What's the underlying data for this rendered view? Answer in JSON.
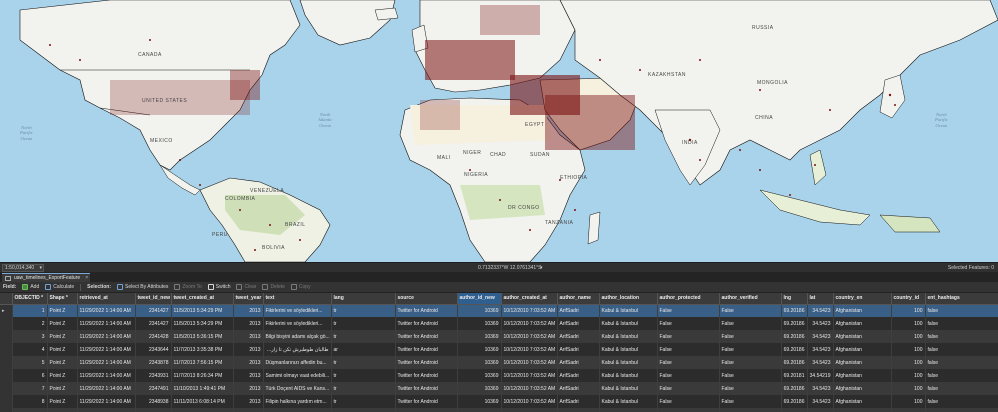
{
  "map": {
    "continent_labels": [
      {
        "id": "canada",
        "text": "CANADA"
      },
      {
        "id": "united-states",
        "text": "UNITED STATES"
      },
      {
        "id": "mexico",
        "text": "MEXICO"
      },
      {
        "id": "brazil",
        "text": "BRAZIL"
      },
      {
        "id": "russia",
        "text": "RUSSIA"
      },
      {
        "id": "kazakhstan",
        "text": "KAZAKHSTAN"
      },
      {
        "id": "mongolia",
        "text": "MONGOLIA"
      },
      {
        "id": "china",
        "text": "CHINA"
      },
      {
        "id": "india",
        "text": "INDIA"
      },
      {
        "id": "mali",
        "text": "MALI"
      },
      {
        "id": "niger",
        "text": "NIGER"
      },
      {
        "id": "chad",
        "text": "CHAD"
      },
      {
        "id": "sudan",
        "text": "SUDAN"
      },
      {
        "id": "egypt",
        "text": "EGYPT"
      },
      {
        "id": "ethiopia",
        "text": "ETHIOPIA"
      },
      {
        "id": "nigeria",
        "text": "NIGERIA"
      },
      {
        "id": "dr-congo",
        "text": "DR CONGO"
      },
      {
        "id": "tanzania",
        "text": "TANZANIA"
      },
      {
        "id": "peru",
        "text": "PERU"
      },
      {
        "id": "bolivia",
        "text": "BOLIVIA"
      },
      {
        "id": "colombia",
        "text": "COLOMBIA"
      },
      {
        "id": "venezuela",
        "text": "VENEZUELA"
      }
    ],
    "ocean_labels": [
      {
        "id": "north-pacific",
        "text": "North\nPacific\nOcean"
      },
      {
        "id": "north-atlantic",
        "text": "North\nAtlantic\nOcean"
      },
      {
        "id": "north-pacific-east",
        "text": "North\nPacific\nOcean"
      }
    ]
  },
  "statusbar": {
    "scale": "1:50,014,340",
    "coordinates": "0.7132337°W 12.0761341°S",
    "selected_features": "Selected Features: 0"
  },
  "table_tab": {
    "title": "uaw_timelines_ExportFeature"
  },
  "toolbar": {
    "field_label": "Field:",
    "add": "Add",
    "calculate": "Calculate",
    "selection_label": "Selection:",
    "select_by_attributes": "Select By Attributes",
    "zoom_to": "Zoom To",
    "switch": "Switch",
    "clear": "Clear",
    "delete": "Delete",
    "copy": "Copy"
  },
  "table": {
    "columns": [
      "",
      "OBJECTID *",
      "Shape *",
      "retrieved_at",
      "tweet_id_new",
      "tweet_created_at",
      "tweet_year",
      "text",
      "lang",
      "source",
      "author_id_new",
      "author_created_at",
      "author_name",
      "author_location",
      "author_protected",
      "author_verified",
      "lng",
      "lat",
      "country_en",
      "country_id",
      "ent_hashtags"
    ],
    "rows": [
      [
        "▸",
        "1",
        "Point Z",
        "11/29/2022 1:14:00 AM",
        "2341427",
        "11/5/2013 5:34:29 PM",
        "2013",
        "Fikirlerini ve söyledikleri...",
        "tr",
        "Twitter for Android",
        "10369",
        "10/12/2010 7:03:52 AM",
        "ArifSadri",
        "Kabul & Istanbul",
        "False",
        "False",
        "69.20186",
        "34.5423",
        "Afghanistan",
        "100",
        "false"
      ],
      [
        "",
        "2",
        "Point Z",
        "11/29/2022 1:14:00 AM",
        "2341427",
        "11/5/2013 5:34:29 PM",
        "2013",
        "Fikirlerini ve söyledikleri...",
        "tr",
        "Twitter for Android",
        "10369",
        "10/12/2010 7:03:52 AM",
        "ArifSadri",
        "Kabul & Istanbul",
        "False",
        "False",
        "69.20186",
        "34.5423",
        "Afghanistan",
        "100",
        "false"
      ],
      [
        "",
        "3",
        "Point Z",
        "11/29/2022 1:14:00 AM",
        "2341428",
        "11/5/2013 5:36:15 PM",
        "2013",
        "Bilgi bisyini adamı alçak gö...",
        "tr",
        "Twitter for Android",
        "10369",
        "10/12/2010 7:03:52 AM",
        "ArifSadri",
        "Kabul & Istanbul",
        "False",
        "False",
        "69.20186",
        "34.5423",
        "Afghanistan",
        "100",
        "false"
      ],
      [
        "",
        "4",
        "Point Z",
        "11/29/2022 1:14:00 AM",
        "2343644",
        "11/7/2013 3:35:38 PM",
        "2013",
        "طالبان طوطبرش تکن تا زار...",
        "ar",
        "Twitter for Android",
        "10369",
        "10/12/2010 7:03:52 AM",
        "ArifSadri",
        "Kabul & Istanbul",
        "False",
        "False",
        "69.20186",
        "34.5423",
        "Afghanistan",
        "100",
        "false"
      ],
      [
        "",
        "5",
        "Point Z",
        "11/29/2022 1:14:00 AM",
        "2343878",
        "11/7/2013 7:56:15 PM",
        "2013",
        "Düşmanlarınızı affedin bu...",
        "tr",
        "Twitter for Android",
        "10369",
        "10/12/2010 7:03:52 AM",
        "ArifSadri",
        "Kabul & Istanbul",
        "False",
        "False",
        "69.20186",
        "34.5423",
        "Afghanistan",
        "100",
        "false"
      ],
      [
        "",
        "6",
        "Point Z",
        "11/29/2022 1:14:00 AM",
        "2343931",
        "11/7/2013 8:26:34 PM",
        "2013",
        "Samimi olmayı vaat edebili...",
        "tr",
        "Twitter for Android",
        "10369",
        "10/12/2010 7:03:52 AM",
        "ArifSadri",
        "Kabul & Istanbul",
        "False",
        "False",
        "69.20181",
        "34.54219",
        "Afghanistan",
        "100",
        "false"
      ],
      [
        "",
        "7",
        "Point Z",
        "11/29/2022 1:14:00 AM",
        "2347491",
        "11/10/2013 1:49:41 PM",
        "2013",
        "Türk Doçent AIDS ve Kans...",
        "tr",
        "Twitter for Android",
        "10369",
        "10/12/2010 7:03:52 AM",
        "ArifSadri",
        "Kabul & Istanbul",
        "False",
        "False",
        "69.20186",
        "34.5423",
        "Afghanistan",
        "100",
        "false"
      ],
      [
        "",
        "8",
        "Point Z",
        "11/29/2022 1:14:00 AM",
        "2348938",
        "11/11/2013 6:08:14 PM",
        "2013",
        "Filipin halkına yardım etm...",
        "tr",
        "Twitter for Android",
        "10369",
        "10/12/2010 7:03:52 AM",
        "ArifSadri",
        "Kabul & Istanbul",
        "False",
        "False",
        "69.20186",
        "34.5423",
        "Afghanistan",
        "100",
        "false"
      ],
      [
        "",
        "9",
        "Point Z",
        "11/29/2022 1:14:00 AM",
        "2348970",
        "11/11/2013 6:27:02 PM",
        "2013",
        "...چرا ستونی با مشوره های",
        "ar",
        "Twitter for Android",
        "10369",
        "10/12/2010 7:03:52 AM",
        "ArifSadri",
        "Kabul & Istanbul",
        "False",
        "False",
        "69.20186",
        "34.5423",
        "Afghanistan",
        "100",
        "false"
      ]
    ]
  },
  "colors": {
    "ocean": "#a9d3ea",
    "land": "#f2f2ee",
    "points": "#7a1212",
    "selected_row": "#3a5f86",
    "highlight_column": "#2f5f8f"
  }
}
